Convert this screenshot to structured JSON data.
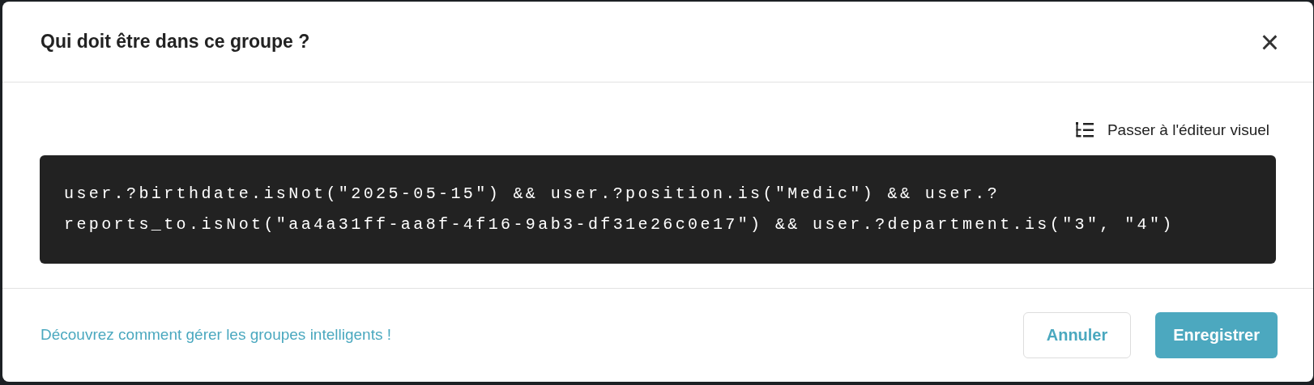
{
  "dialog": {
    "title": "Qui doit être dans ce groupe ?",
    "close": "×"
  },
  "editor_switch": {
    "label": "Passer à l'éditeur visuel"
  },
  "code": {
    "lines": [
      "user.?birthdate.isNot(\"2025-05-15\") && user.?position.is(\"Medic\") && user.?",
      "reports_to.isNot(\"aa4a31ff-aa8f-4f16-9ab3-df31e26c0e17\") && user.?department.is(\"3\", \"4\")"
    ]
  },
  "footer": {
    "help_link": "Découvrez comment gérer les groupes intelligents !",
    "buttons": [
      {
        "label": "Annuler",
        "kind": "secondary"
      },
      {
        "label": "Enregistrer",
        "kind": "primary"
      }
    ]
  }
}
